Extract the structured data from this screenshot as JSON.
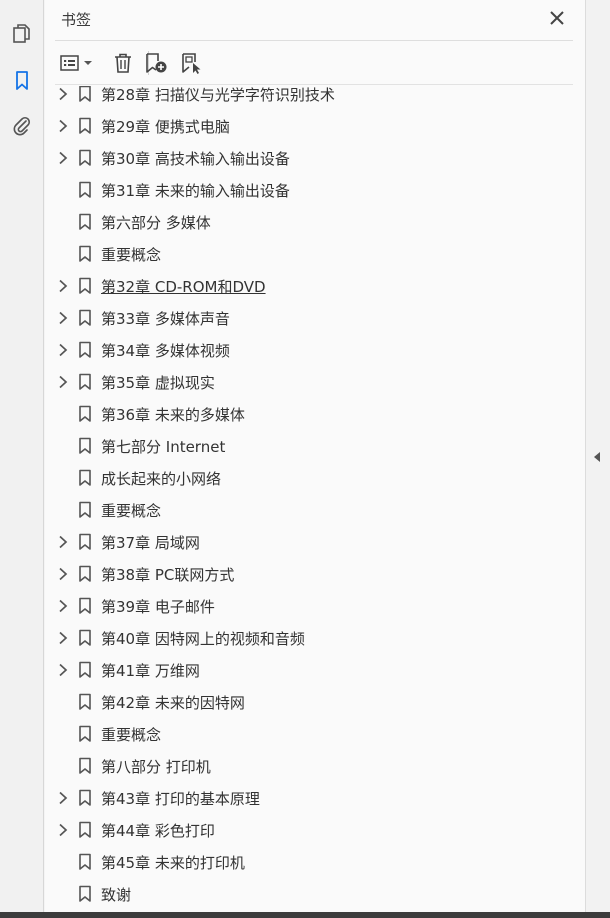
{
  "rail": {
    "icons": [
      "pages-icon",
      "bookmarks-icon",
      "attachments-icon"
    ],
    "accent_color": "#1473e6"
  },
  "panel": {
    "title": "书签"
  },
  "toolbar": {
    "buttons": [
      "options-menu",
      "delete-bookmark",
      "new-bookmark",
      "new-bookmark-from-structure"
    ]
  },
  "bookmarks": [
    {
      "label": "第28章 扫描仪与光学字符识别技术",
      "expandable": true
    },
    {
      "label": "第29章 便携式电脑",
      "expandable": true
    },
    {
      "label": "第30章 高技术输入输出设备",
      "expandable": true
    },
    {
      "label": "第31章 未来的输入输出设备",
      "expandable": false
    },
    {
      "label": "第六部分 多媒体",
      "expandable": false
    },
    {
      "label": "重要概念",
      "expandable": false
    },
    {
      "label": "第32章 CD-ROM和DVD",
      "expandable": true,
      "underlined": true
    },
    {
      "label": "第33章 多媒体声音",
      "expandable": true
    },
    {
      "label": "第34章 多媒体视频",
      "expandable": true
    },
    {
      "label": "第35章 虚拟现实",
      "expandable": true
    },
    {
      "label": "第36章 未来的多媒体",
      "expandable": false
    },
    {
      "label": "第七部分 Internet",
      "expandable": false
    },
    {
      "label": "成长起来的小网络",
      "expandable": false
    },
    {
      "label": "重要概念",
      "expandable": false
    },
    {
      "label": "第37章 局域网",
      "expandable": true
    },
    {
      "label": "第38章 PC联网方式",
      "expandable": true
    },
    {
      "label": "第39章 电子邮件",
      "expandable": true
    },
    {
      "label": "第40章 因特网上的视频和音频",
      "expandable": true
    },
    {
      "label": "第41章 万维网",
      "expandable": true
    },
    {
      "label": "第42章 未来的因特网",
      "expandable": false
    },
    {
      "label": "重要概念",
      "expandable": false
    },
    {
      "label": "第八部分 打印机",
      "expandable": false
    },
    {
      "label": "第43章 打印的基本原理",
      "expandable": true
    },
    {
      "label": "第44章 彩色打印",
      "expandable": true
    },
    {
      "label": "第45章 未来的打印机",
      "expandable": false
    },
    {
      "label": "致谢",
      "expandable": false
    }
  ]
}
